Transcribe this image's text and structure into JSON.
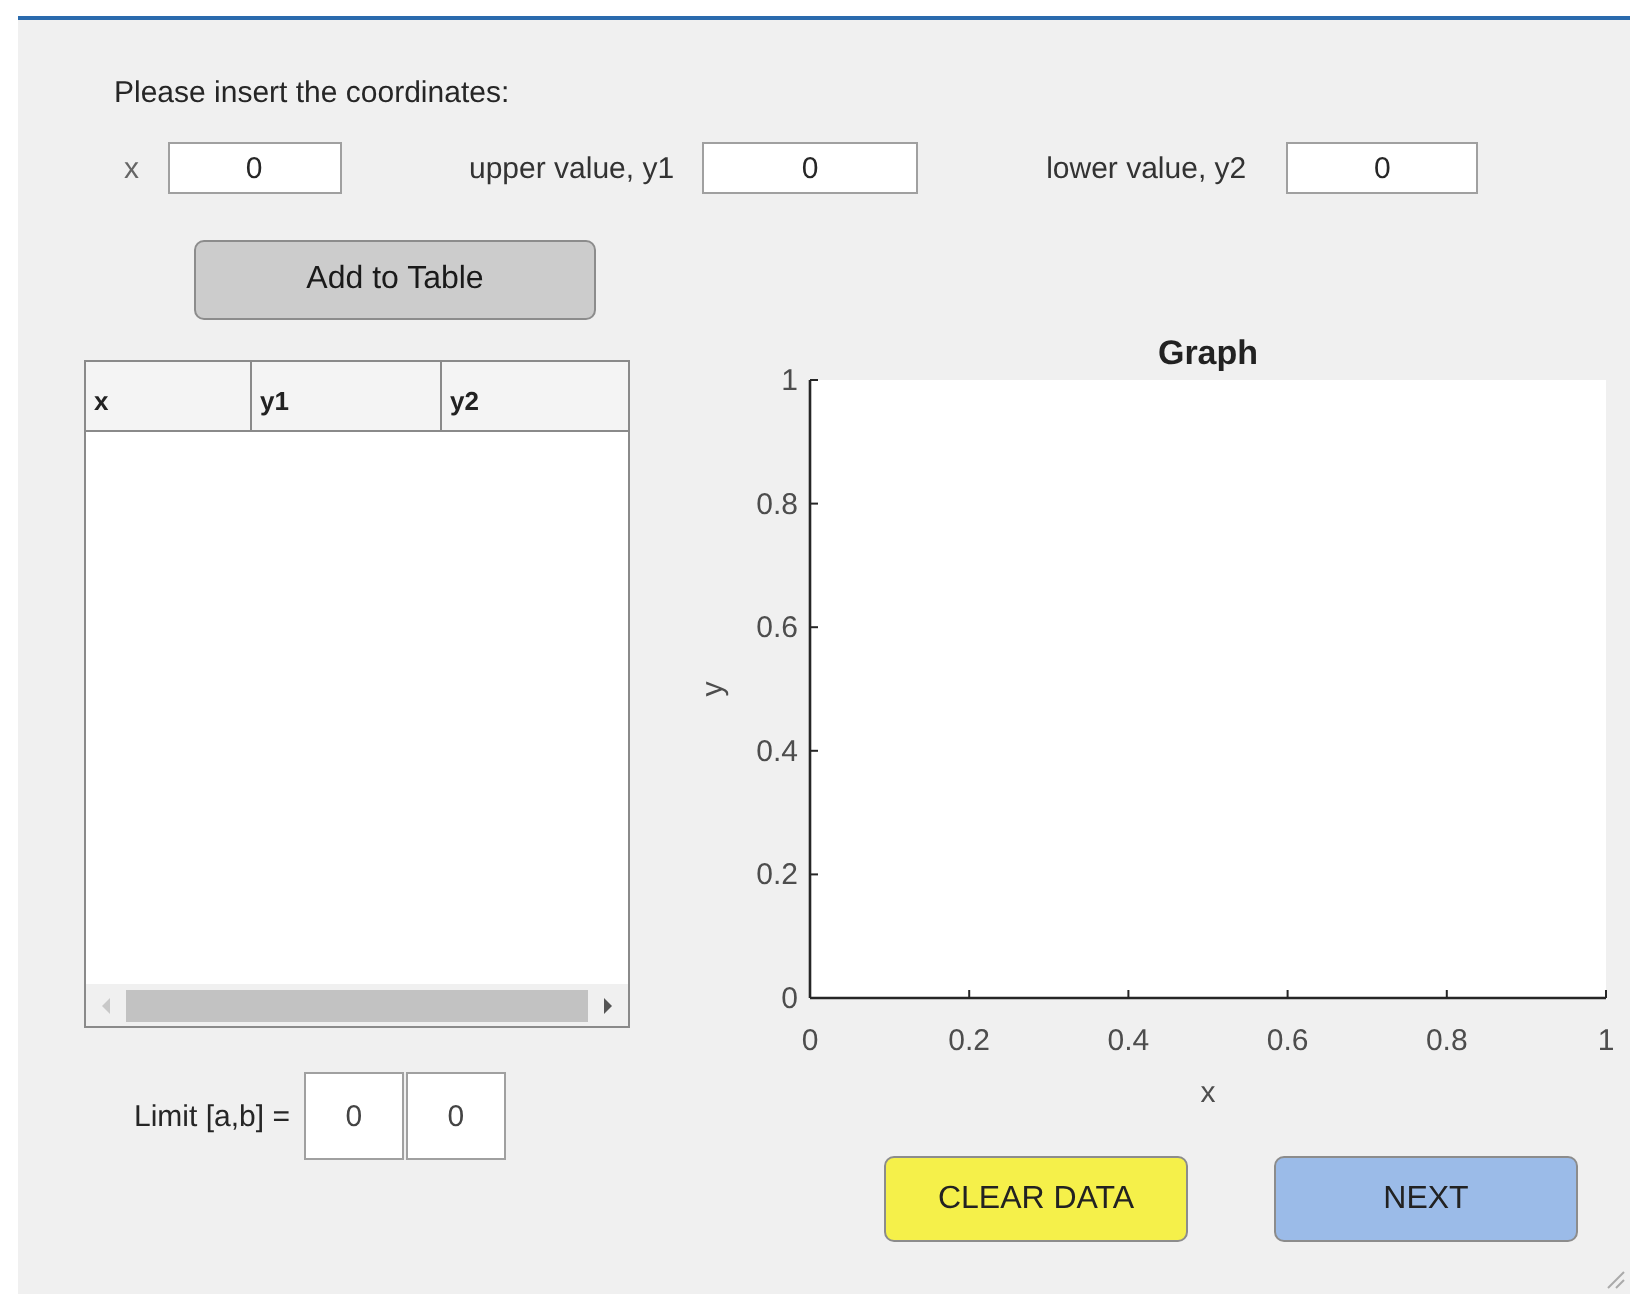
{
  "prompt": "Please insert the coordinates:",
  "fields": [
    {
      "label": "x",
      "value": "0"
    },
    {
      "label": "upper value, y1",
      "value": "0"
    },
    {
      "label": "lower value, y2",
      "value": "0"
    }
  ],
  "add_button": "Add to Table",
  "table": {
    "columns": [
      "x",
      "y1",
      "y2"
    ]
  },
  "limit": {
    "label": "Limit [a,b] =",
    "values": [
      "0",
      "0"
    ]
  },
  "graph": {
    "chart_data": {
      "type": "line",
      "title": "Graph",
      "xlabel": "x",
      "ylabel": "y",
      "xlim": [
        0,
        1
      ],
      "ylim": [
        0,
        1
      ],
      "xticks": [
        0,
        0.2,
        0.4,
        0.6,
        0.8,
        1
      ],
      "yticks": [
        0,
        0.2,
        0.4,
        0.6,
        0.8,
        1
      ]
    }
  },
  "buttons": [
    {
      "label": "CLEAR DATA",
      "color": "#f5f04a"
    },
    {
      "label": "NEXT",
      "color": "#9bbbe8"
    }
  ]
}
